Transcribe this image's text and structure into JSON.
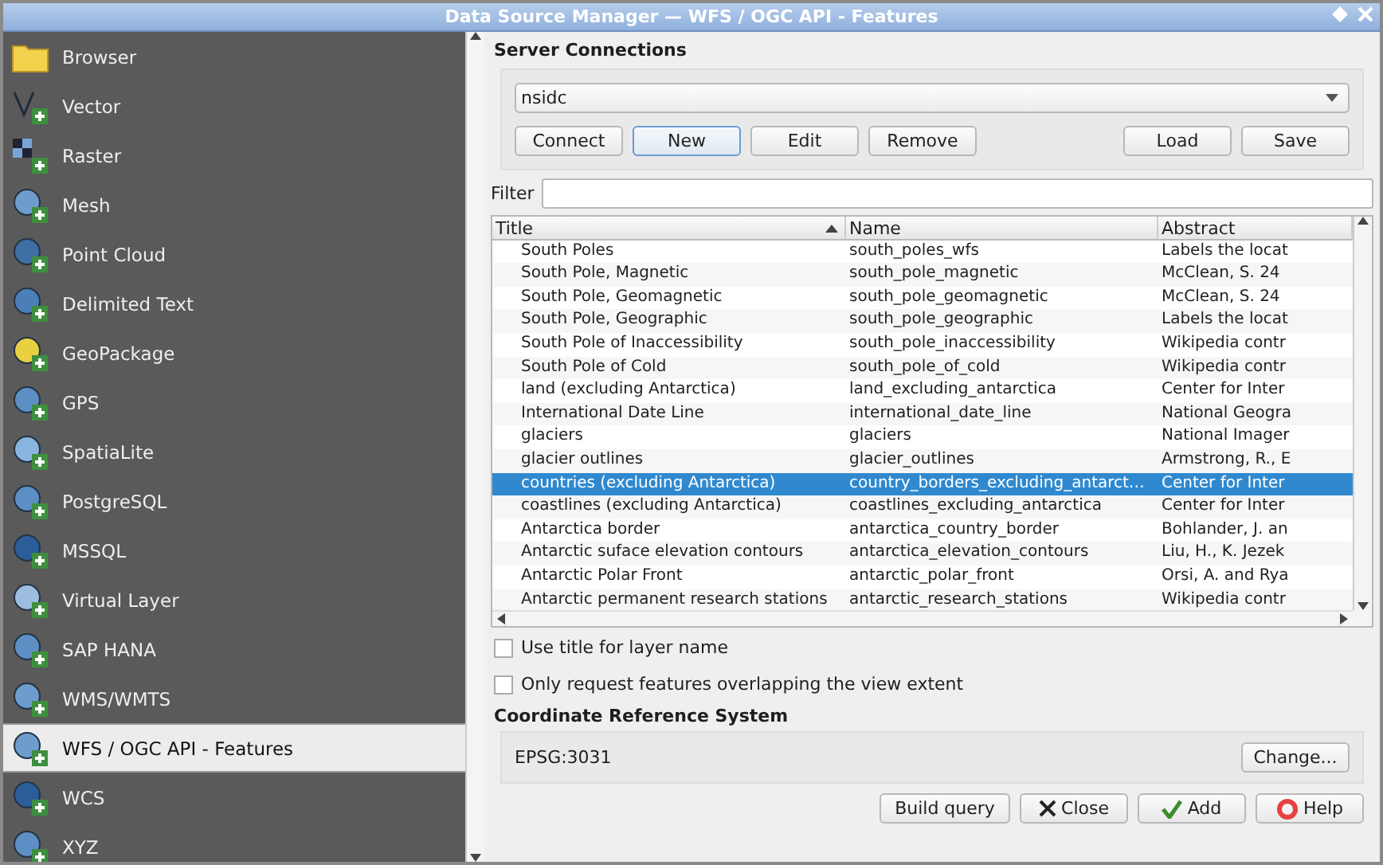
{
  "window": {
    "title": "Data Source Manager — WFS / OGC API - Features"
  },
  "sidebar": {
    "items": [
      {
        "label": "Browser",
        "selected": false
      },
      {
        "label": "Vector",
        "selected": false
      },
      {
        "label": "Raster",
        "selected": false
      },
      {
        "label": "Mesh",
        "selected": false
      },
      {
        "label": "Point Cloud",
        "selected": false
      },
      {
        "label": "Delimited Text",
        "selected": false
      },
      {
        "label": "GeoPackage",
        "selected": false
      },
      {
        "label": "GPS",
        "selected": false
      },
      {
        "label": "SpatiaLite",
        "selected": false
      },
      {
        "label": "PostgreSQL",
        "selected": false
      },
      {
        "label": "MSSQL",
        "selected": false
      },
      {
        "label": "Virtual Layer",
        "selected": false
      },
      {
        "label": "SAP HANA",
        "selected": false
      },
      {
        "label": "WMS/WMTS",
        "selected": false
      },
      {
        "label": "WFS / OGC API - Features",
        "selected": true
      },
      {
        "label": "WCS",
        "selected": false
      },
      {
        "label": "XYZ",
        "selected": false
      }
    ]
  },
  "server_connections": {
    "title": "Server Connections",
    "connection": "nsidc",
    "buttons": [
      {
        "label": "Connect",
        "focused": false
      },
      {
        "label": "New",
        "focused": true
      },
      {
        "label": "Edit",
        "focused": false
      },
      {
        "label": "Remove",
        "focused": false
      }
    ],
    "file_buttons": [
      "Load",
      "Save"
    ]
  },
  "filter": {
    "label": "Filter"
  },
  "table": {
    "columns": [
      "Title",
      "Name",
      "Abstract"
    ],
    "rows": [
      {
        "cells": [
          "South Poles",
          "south_poles_wfs",
          "Labels the locat"
        ],
        "selected": false
      },
      {
        "cells": [
          "South Pole, Magnetic",
          "south_pole_magnetic",
          "McClean, S. 24"
        ],
        "selected": false
      },
      {
        "cells": [
          "South Pole, Geomagnetic",
          "south_pole_geomagnetic",
          "McClean, S. 24"
        ],
        "selected": false
      },
      {
        "cells": [
          "South Pole, Geographic",
          "south_pole_geographic",
          "Labels the locat"
        ],
        "selected": false
      },
      {
        "cells": [
          "South Pole of Inaccessibility",
          "south_pole_inaccessibility",
          "Wikipedia contr"
        ],
        "selected": false
      },
      {
        "cells": [
          "South Pole of Cold",
          "south_pole_of_cold",
          "Wikipedia contr"
        ],
        "selected": false
      },
      {
        "cells": [
          "land (excluding Antarctica)",
          "land_excluding_antarctica",
          "Center for Inter"
        ],
        "selected": false
      },
      {
        "cells": [
          "International Date Line",
          "international_date_line",
          "National Geogra"
        ],
        "selected": false
      },
      {
        "cells": [
          "glaciers",
          "glaciers",
          "National Imager"
        ],
        "selected": false
      },
      {
        "cells": [
          "glacier outlines",
          "glacier_outlines",
          "Armstrong, R., E"
        ],
        "selected": false
      },
      {
        "cells": [
          "countries (excluding Antarctica)",
          "country_borders_excluding_antarct…",
          "Center for Inter"
        ],
        "selected": true
      },
      {
        "cells": [
          "coastlines (excluding Antarctica)",
          "coastlines_excluding_antarctica",
          "Center for Inter"
        ],
        "selected": false
      },
      {
        "cells": [
          "Antarctica border",
          "antarctica_country_border",
          "Bohlander, J. an"
        ],
        "selected": false
      },
      {
        "cells": [
          "Antarctic suface elevation contours",
          "antarctica_elevation_contours",
          "Liu, H., K. Jezek"
        ],
        "selected": false
      },
      {
        "cells": [
          "Antarctic Polar Front",
          "antarctic_polar_front",
          "Orsi, A. and Rya"
        ],
        "selected": false
      },
      {
        "cells": [
          "Antarctic permanent research stations",
          "antarctic_research_stations",
          "Wikipedia contr"
        ],
        "selected": false
      }
    ]
  },
  "options": [
    {
      "label": "Use title for layer name",
      "checked": false
    },
    {
      "label": "Only request features overlapping the view extent",
      "checked": false
    }
  ],
  "crs": {
    "title": "Coordinate Reference System",
    "value": "EPSG:3031",
    "button": "Change..."
  },
  "footer_buttons": [
    {
      "label": "Build query",
      "kind": "plain"
    },
    {
      "label": "Close",
      "kind": "close"
    },
    {
      "label": "Add",
      "kind": "add"
    },
    {
      "label": "Help",
      "kind": "help"
    }
  ]
}
